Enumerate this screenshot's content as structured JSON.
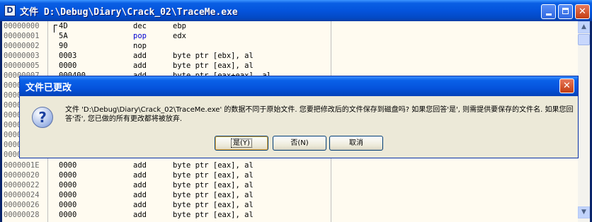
{
  "window": {
    "app_icon_letter": "D",
    "title": "文件 D:\\Debug\\Diary\\Crack_02\\TraceMe.exe"
  },
  "disasm_top": [
    {
      "addr": "00000000",
      "hex": "4D",
      "mnem": "dec",
      "ops": "ebp"
    },
    {
      "addr": "00000001",
      "hex": "5A",
      "mnem": "pop",
      "ops": "edx"
    },
    {
      "addr": "00000002",
      "hex": "90",
      "mnem": "nop",
      "ops": ""
    },
    {
      "addr": "00000003",
      "hex": "0003",
      "mnem": "add",
      "ops": "byte ptr [ebx], al"
    },
    {
      "addr": "00000005",
      "hex": "0000",
      "mnem": "add",
      "ops": "byte ptr [eax], al"
    }
  ],
  "disasm_partial": {
    "addr": "00000007",
    "hex": "000400",
    "mnem": "add",
    "ops": "byte ptr [eax+eax], al"
  },
  "hidden_rows_addr_prefix": [
    "0000",
    "0000",
    "0000",
    "0000",
    "0000",
    "0000",
    "0000",
    "0000"
  ],
  "disasm_bottom": [
    {
      "addr": "0000001E",
      "hex": "0000",
      "mnem": "add",
      "ops": "byte ptr [eax], al"
    },
    {
      "addr": "00000020",
      "hex": "0000",
      "mnem": "add",
      "ops": "byte ptr [eax], al"
    },
    {
      "addr": "00000022",
      "hex": "0000",
      "mnem": "add",
      "ops": "byte ptr [eax], al"
    },
    {
      "addr": "00000024",
      "hex": "0000",
      "mnem": "add",
      "ops": "byte ptr [eax], al"
    },
    {
      "addr": "00000026",
      "hex": "0000",
      "mnem": "add",
      "ops": "byte ptr [eax], al"
    },
    {
      "addr": "00000028",
      "hex": "0000",
      "mnem": "add",
      "ops": "byte ptr [eax], al"
    }
  ],
  "dialog": {
    "title": "文件已更改",
    "close_glyph": "✕",
    "question_glyph": "?",
    "message": "文件 'D:\\Debug\\Diary\\Crack_02\\TraceMe.exe' 的数据不同于原始文件. 您要把修改后的文件保存到磁盘吗? 如果您回答'是', 则需提供要保存的文件名. 如果您回答'否', 您已做的所有更改都将被放弃.",
    "buttons": {
      "yes": "是(Y)",
      "no": "否(N)",
      "cancel": "取消"
    }
  },
  "scrollbar": {
    "up_glyph": "▲",
    "down_glyph": "▼"
  },
  "colors": {
    "accent": "#0a5fe4",
    "mnemonic_pop": "#0000d0",
    "listing_bg": "#fffbf0"
  }
}
